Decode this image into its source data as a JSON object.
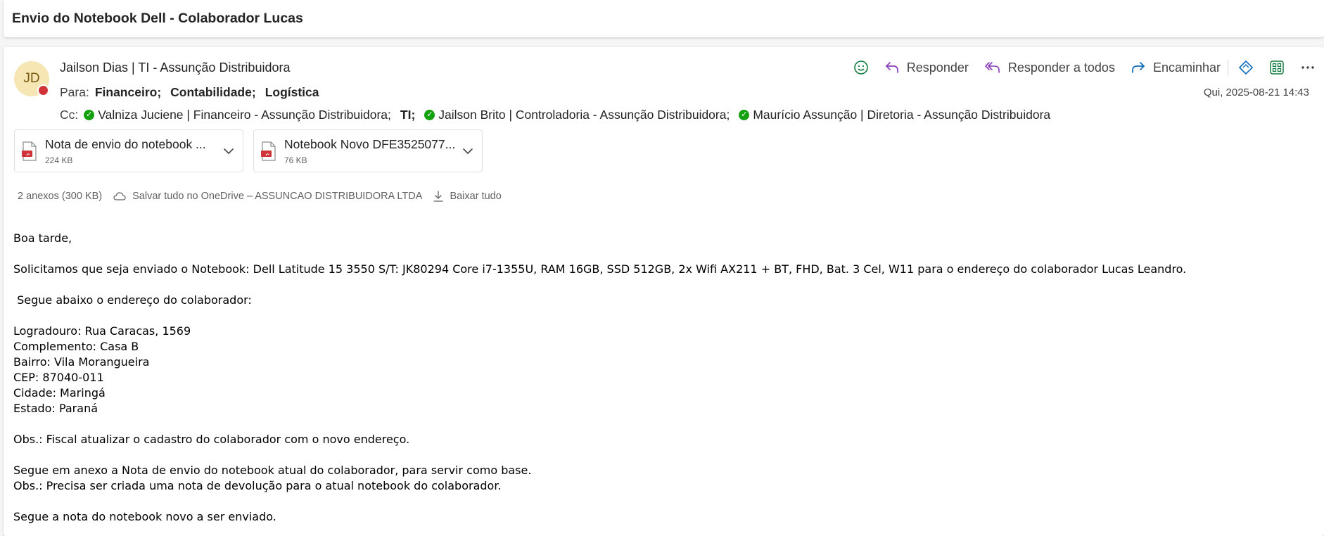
{
  "subject": "Envio do Notebook Dell - Colaborador Lucas",
  "sender": {
    "initials": "JD",
    "name": "Jailson Dias | TI - Assunção Distribuidora"
  },
  "to": {
    "label": "Para:",
    "recipients": [
      "Financeiro;",
      "Contabilidade;",
      "Logística"
    ]
  },
  "cc": {
    "label": "Cc:",
    "recipients": [
      "Valniza Juciene | Financeiro - Assunção Distribuidora;",
      "TI;",
      "Jailson Brito | Controladoria - Assunção Distribuidora;",
      "Maurício Assunção | Diretoria - Assunção Distribuidora"
    ]
  },
  "actions": {
    "reply": "Responder",
    "reply_all": "Responder a todos",
    "forward": "Encaminhar"
  },
  "date": "Qui, 2025-08-21 14:43",
  "attachments": [
    {
      "name": "Nota de envio do notebook ...",
      "size": "224 KB"
    },
    {
      "name": "Notebook Novo DFE3525077...",
      "size": "76 KB"
    }
  ],
  "attachment_meta": {
    "count": "2 anexos (300 KB)",
    "save_onedrive": "Salvar tudo no OneDrive – ASSUNCAO DISTRIBUIDORA LTDA",
    "download_all": "Baixar tudo"
  },
  "body": {
    "greeting": "Boa tarde,",
    "request": "Solicitamos que seja enviado o Notebook: Dell Latitude 15 3550 S/T: JK80294 Core i7-1355U, RAM 16GB, SSD 512GB, 2x Wifi AX211 + BT, FHD, Bat. 3 Cel, W11 para o endereço do colaborador Lucas Leandro.",
    "address_intro": " Segue abaixo o endereço do colaborador:",
    "address": [
      "Logradouro: Rua Caracas, 1569",
      "Complemento: Casa B",
      "Bairro: Vila Morangueira",
      "CEP: 87040-011",
      "Cidade: Maringá",
      "Estado: Paraná"
    ],
    "obs1": "Obs.: Fiscal atualizar o cadastro do colaborador com o novo endereço.",
    "annex_line": "Segue em anexo a Nota de envio do notebook atual do colaborador, para servir como base.",
    "obs2": "Obs.: Precisa ser criada uma nota de devolução para o atual notebook do colaborador.",
    "closing": "Segue a nota do notebook novo a ser enviado."
  },
  "colors": {
    "accent_purple": "#8a3dba",
    "accent_blue": "#0f6cbd",
    "presence_busy": "#d13438",
    "presence_available": "#13a10e",
    "avatar_bg": "#f6e6b4"
  }
}
